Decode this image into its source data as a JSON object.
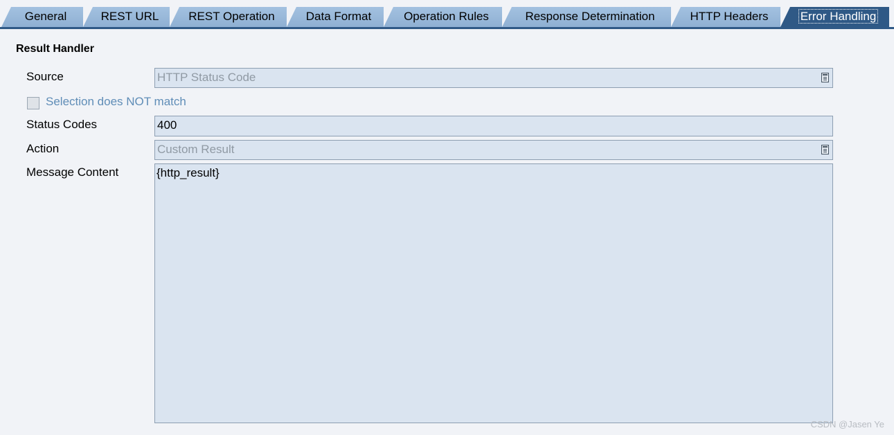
{
  "tabs": [
    {
      "label": "General",
      "active": false
    },
    {
      "label": "REST URL",
      "active": false
    },
    {
      "label": "REST Operation",
      "active": false
    },
    {
      "label": "Data Format",
      "active": false
    },
    {
      "label": "Operation Rules",
      "active": false
    },
    {
      "label": "Response Determination",
      "active": false
    },
    {
      "label": "HTTP Headers",
      "active": false
    },
    {
      "label": "Error Handling",
      "active": true
    }
  ],
  "form": {
    "section_title": "Result Handler",
    "source": {
      "label": "Source",
      "value": "HTTP Status Code",
      "disabled": true
    },
    "selection_not_match": {
      "label": "Selection does NOT match",
      "checked": false,
      "disabled": true
    },
    "status_codes": {
      "label": "Status Codes",
      "value": "400"
    },
    "action": {
      "label": "Action",
      "value": "Custom Result",
      "disabled": true
    },
    "message_content": {
      "label": "Message Content",
      "value": "{http_result}"
    }
  },
  "watermark": "CSDN @Jasen Ye",
  "colors": {
    "tab_inactive": "#98b8da",
    "tab_active": "#2f5986",
    "field_bg": "#dae4f0",
    "page_bg": "#f1f3f7"
  }
}
